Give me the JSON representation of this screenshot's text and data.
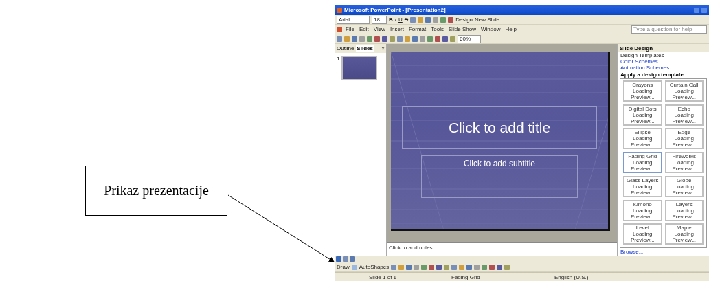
{
  "callout": {
    "text": "Prikaz prezentacije"
  },
  "window": {
    "title": "Microsoft PowerPoint - [Presentation2]"
  },
  "formatting_toolbar": {
    "font": "Arial",
    "size": "18",
    "styles": [
      "B",
      "I",
      "U",
      "S"
    ],
    "design": "Design",
    "new_slide": "New Slide"
  },
  "menu": [
    {
      "label": "File"
    },
    {
      "label": "Edit"
    },
    {
      "label": "View"
    },
    {
      "label": "Insert"
    },
    {
      "label": "Format"
    },
    {
      "label": "Tools"
    },
    {
      "label": "Slide Show"
    },
    {
      "label": "Window"
    },
    {
      "label": "Help"
    }
  ],
  "help_box": {
    "placeholder": "Type a question for help"
  },
  "standard_toolbar": {
    "zoom": "60%"
  },
  "outline_pane": {
    "tabs": [
      {
        "label": "Outline",
        "selected": false
      },
      {
        "label": "Slides",
        "selected": true
      }
    ],
    "close": "×",
    "slides": [
      {
        "number": "1",
        "selected": true
      }
    ]
  },
  "slide": {
    "title": "Click to add title",
    "subtitle": "Click to add subtitle"
  },
  "notes": {
    "placeholder": "Click to add notes"
  },
  "task_pane": {
    "title": "Slide Design",
    "links": [
      "Design Templates",
      "Color Schemes",
      "Animation Schemes"
    ],
    "section": "Apply a design template:",
    "templates": [
      {
        "name": "Crayons",
        "status": "Loading Preview...",
        "selected": false
      },
      {
        "name": "Curtain Call",
        "status": "Loading Preview...",
        "selected": false
      },
      {
        "name": "Digital Dots",
        "status": "Loading Preview...",
        "selected": false
      },
      {
        "name": "Echo",
        "status": "Loading Preview...",
        "selected": false
      },
      {
        "name": "Ellipse",
        "status": "Loading Preview...",
        "selected": false
      },
      {
        "name": "Edge",
        "status": "Loading Preview...",
        "selected": false
      },
      {
        "name": "Fading Grid",
        "status": "Loading Preview...",
        "selected": true
      },
      {
        "name": "Fireworks",
        "status": "Loading Preview...",
        "selected": false
      },
      {
        "name": "Glass Layers",
        "status": "Loading Preview...",
        "selected": false
      },
      {
        "name": "Globe",
        "status": "Loading Preview...",
        "selected": false
      },
      {
        "name": "Kimono",
        "status": "Loading Preview...",
        "selected": false
      },
      {
        "name": "Layers",
        "status": "Loading Preview...",
        "selected": false
      },
      {
        "name": "Level",
        "status": "Loading Preview...",
        "selected": false
      },
      {
        "name": "Maple",
        "status": "Loading Preview...",
        "selected": false
      }
    ],
    "browse": "Browse..."
  },
  "drawing_toolbar": {
    "draw": "Draw",
    "autoshapes": "AutoShapes"
  },
  "status_bar": {
    "slide": "Slide 1 of 1",
    "design": "Fading Grid",
    "language": "English (U.S.)"
  }
}
